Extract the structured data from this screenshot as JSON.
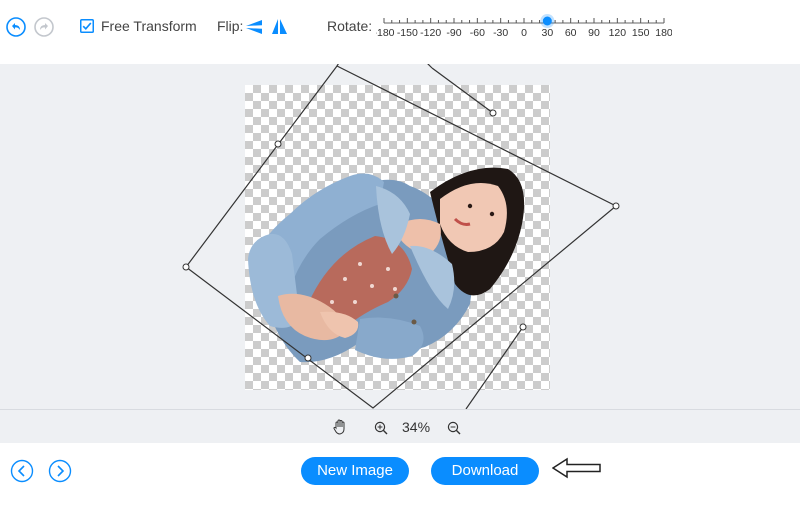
{
  "toolbar": {
    "free_transform_label": "Free Transform",
    "free_transform_checked": true,
    "flip_label": "Flip:",
    "rotate_label": "Rotate:",
    "rotate_ticks": [
      "-180",
      "-150",
      "-120",
      "-90",
      "-60",
      "-30",
      "0",
      "30",
      "60",
      "90",
      "120",
      "150",
      "180"
    ],
    "rotate_value": 30
  },
  "zoom": {
    "level": "34%"
  },
  "footer": {
    "new_image_label": "New Image",
    "download_label": "Download"
  },
  "colors": {
    "accent": "#0a8dff",
    "canvas_bg": "#eef0f3"
  }
}
